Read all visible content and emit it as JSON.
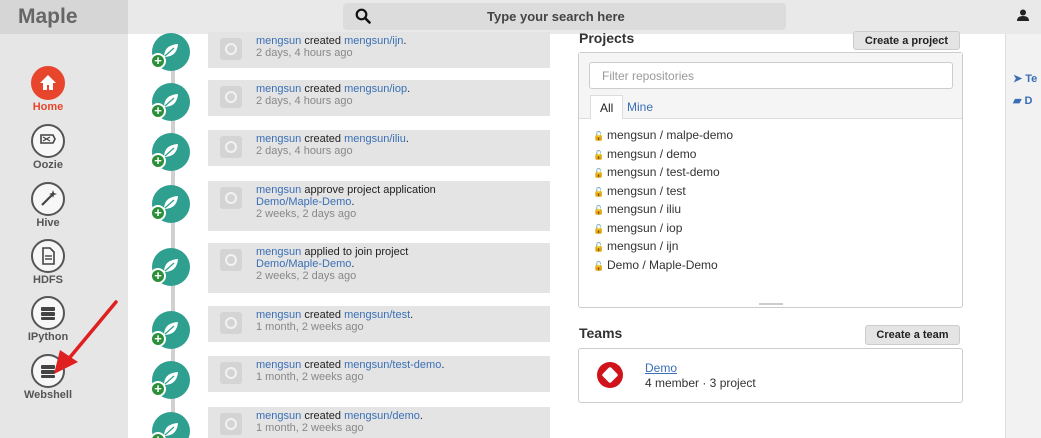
{
  "brand": "Maple",
  "search": {
    "placeholder": "Type your search here"
  },
  "sidebar": {
    "items": [
      {
        "label": "Home",
        "icon": "home-icon",
        "active": true
      },
      {
        "label": "Oozie",
        "icon": "oozie-icon",
        "active": false
      },
      {
        "label": "Hive",
        "icon": "hive-wand-icon",
        "active": false
      },
      {
        "label": "HDFS",
        "icon": "file-icon",
        "active": false
      },
      {
        "label": "IPython",
        "icon": "server-icon",
        "active": false
      },
      {
        "label": "Webshell",
        "icon": "server-icon",
        "active": false
      }
    ]
  },
  "feed": [
    {
      "user": "mengsun",
      "action": "created",
      "target": "mengsun/ijn",
      "suffix": ".",
      "time": "2 days, 4 hours ago"
    },
    {
      "user": "mengsun",
      "action": "created",
      "target": "mengsun/iop",
      "suffix": ".",
      "time": "2 days, 4 hours ago"
    },
    {
      "user": "mengsun",
      "action": "created",
      "target": "mengsun/iliu",
      "suffix": ".",
      "time": "2 days, 4 hours ago"
    },
    {
      "user": "mengsun",
      "action": "approve project application",
      "target": "Demo/Maple-Demo",
      "suffix": ".",
      "time": "2 weeks, 2 days ago"
    },
    {
      "user": "mengsun",
      "action": "applied to join project",
      "target": "Demo/Maple-Demo",
      "suffix": ".",
      "time": "2 weeks, 2 days ago"
    },
    {
      "user": "mengsun",
      "action": "created",
      "target": "mengsun/test",
      "suffix": ".",
      "time": "1 month, 2 weeks ago"
    },
    {
      "user": "mengsun",
      "action": "created",
      "target": "mengsun/test-demo",
      "suffix": ".",
      "time": "1 month, 2 weeks ago"
    },
    {
      "user": "mengsun",
      "action": "created",
      "target": "mengsun/demo",
      "suffix": ".",
      "time": "1 month, 2 weeks ago"
    }
  ],
  "projects": {
    "title": "Projects",
    "create_label": "Create a project",
    "filter_placeholder": "Filter repositories",
    "tabs": [
      "All",
      "Mine"
    ],
    "repos": [
      "mengsun / malpe-demo",
      "mengsun / demo",
      "mengsun / test-demo",
      "mengsun / test",
      "mengsun / iliu",
      "mengsun / iop",
      "mengsun / ijn",
      "Demo / Maple-Demo"
    ]
  },
  "teams": {
    "title": "Teams",
    "create_label": "Create a team",
    "items": [
      {
        "name": "Demo",
        "meta": "4 member · 3 project"
      }
    ]
  },
  "right_panel": {
    "links": [
      "Te",
      "D"
    ]
  },
  "colors": {
    "accent": "#e8462c",
    "link": "#3a6fb5",
    "timeline_badge": "#2f9f8f",
    "annotation_arrow": "#e02020"
  }
}
